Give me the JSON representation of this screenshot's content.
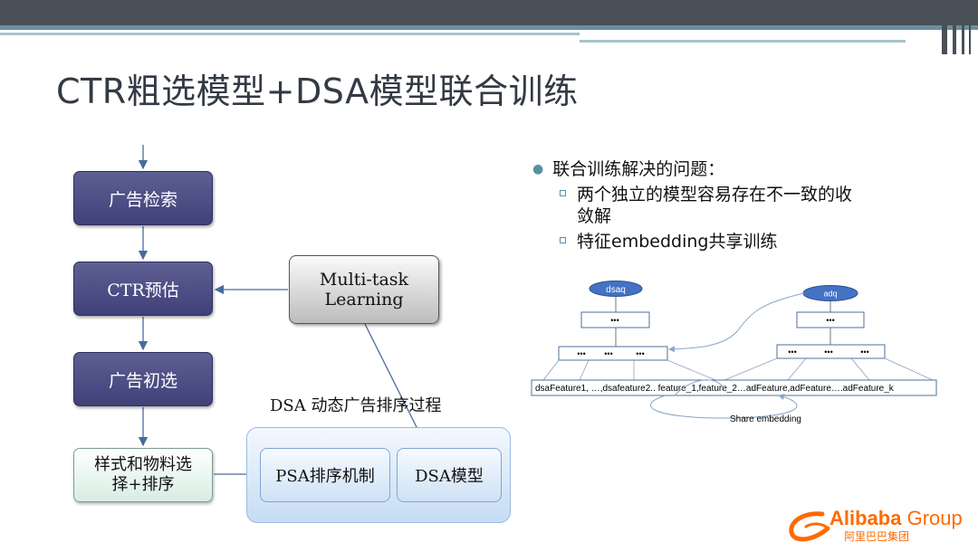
{
  "slide": {
    "title": "CTR粗选模型+DSA模型联合训练"
  },
  "flow": {
    "retrieval": "广告检索",
    "ctr": "CTR预估",
    "prescreen": "广告初选",
    "style_line1": "样式和物料选",
    "style_line2": "择+排序",
    "multitask_line1": "Multi-task",
    "multitask_line2": "Learning",
    "dsa_caption": "DSA 动态广告排序过程",
    "psa": "PSA排序机制",
    "dsa_model": "DSA模型"
  },
  "bullets": {
    "main": "联合训练解决的问题：",
    "sub1_line1": "两个独立的模型容易存在不一致的收",
    "sub1_line2": "敛解",
    "sub2": "特征embedding共享训练"
  },
  "network": {
    "left_output": "dsaq",
    "right_output": "adq",
    "ellipsis": "•••",
    "features": "dsaFeature1, …,dsafeature2.. feature_1,feature_2…adFeature,adFeature….adFeature_k",
    "share_label": "Share embedding"
  },
  "logo": {
    "brand": "Alibaba",
    "group": "Group",
    "sub": "阿里巴巴集团"
  },
  "colors": {
    "navy_box": "#4a4b84",
    "green_box": "#d7ede3",
    "oval": "#4472c4",
    "accent": "#ff6a00"
  }
}
